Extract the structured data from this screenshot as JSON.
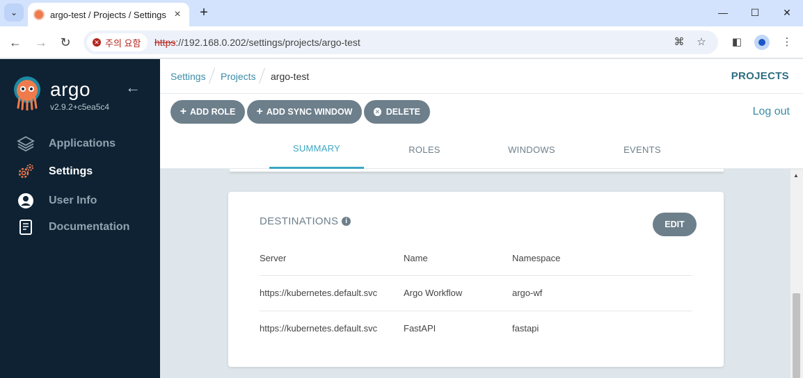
{
  "browser": {
    "tab_title": "argo-test / Projects / Settings",
    "security_label": "주의 요함",
    "url_scheme": "https",
    "url_rest": "://192.168.0.202/settings/projects/argo-test"
  },
  "sidebar": {
    "brand": "argo",
    "version": "v2.9.2+c5ea5c4",
    "items": [
      {
        "label": "Applications",
        "icon": "layers-icon",
        "active": false
      },
      {
        "label": "Settings",
        "icon": "gears-icon",
        "active": true
      },
      {
        "label": "User Info",
        "icon": "user-icon",
        "active": false
      },
      {
        "label": "Documentation",
        "icon": "book-icon",
        "active": false
      }
    ]
  },
  "header": {
    "breadcrumbs": [
      "Settings",
      "Projects",
      "argo-test"
    ],
    "right_label": "PROJECTS"
  },
  "actions": {
    "add_role": "ADD ROLE",
    "add_sync_window": "ADD SYNC WINDOW",
    "delete": "DELETE",
    "logout": "Log out"
  },
  "tabs": [
    "SUMMARY",
    "ROLES",
    "WINDOWS",
    "EVENTS"
  ],
  "destinations": {
    "title": "DESTINATIONS",
    "edit_label": "EDIT",
    "columns": [
      "Server",
      "Name",
      "Namespace"
    ],
    "rows": [
      [
        "https://kubernetes.default.svc",
        "Argo Workflow",
        "argo-wf"
      ],
      [
        "https://kubernetes.default.svc",
        "FastAPI",
        "fastapi"
      ]
    ]
  },
  "colors": {
    "sidebar_bg": "#0e2233",
    "accent": "#3aa7c4",
    "button_bg": "#6d7f8b",
    "logo_orange": "#ef7b4d"
  }
}
